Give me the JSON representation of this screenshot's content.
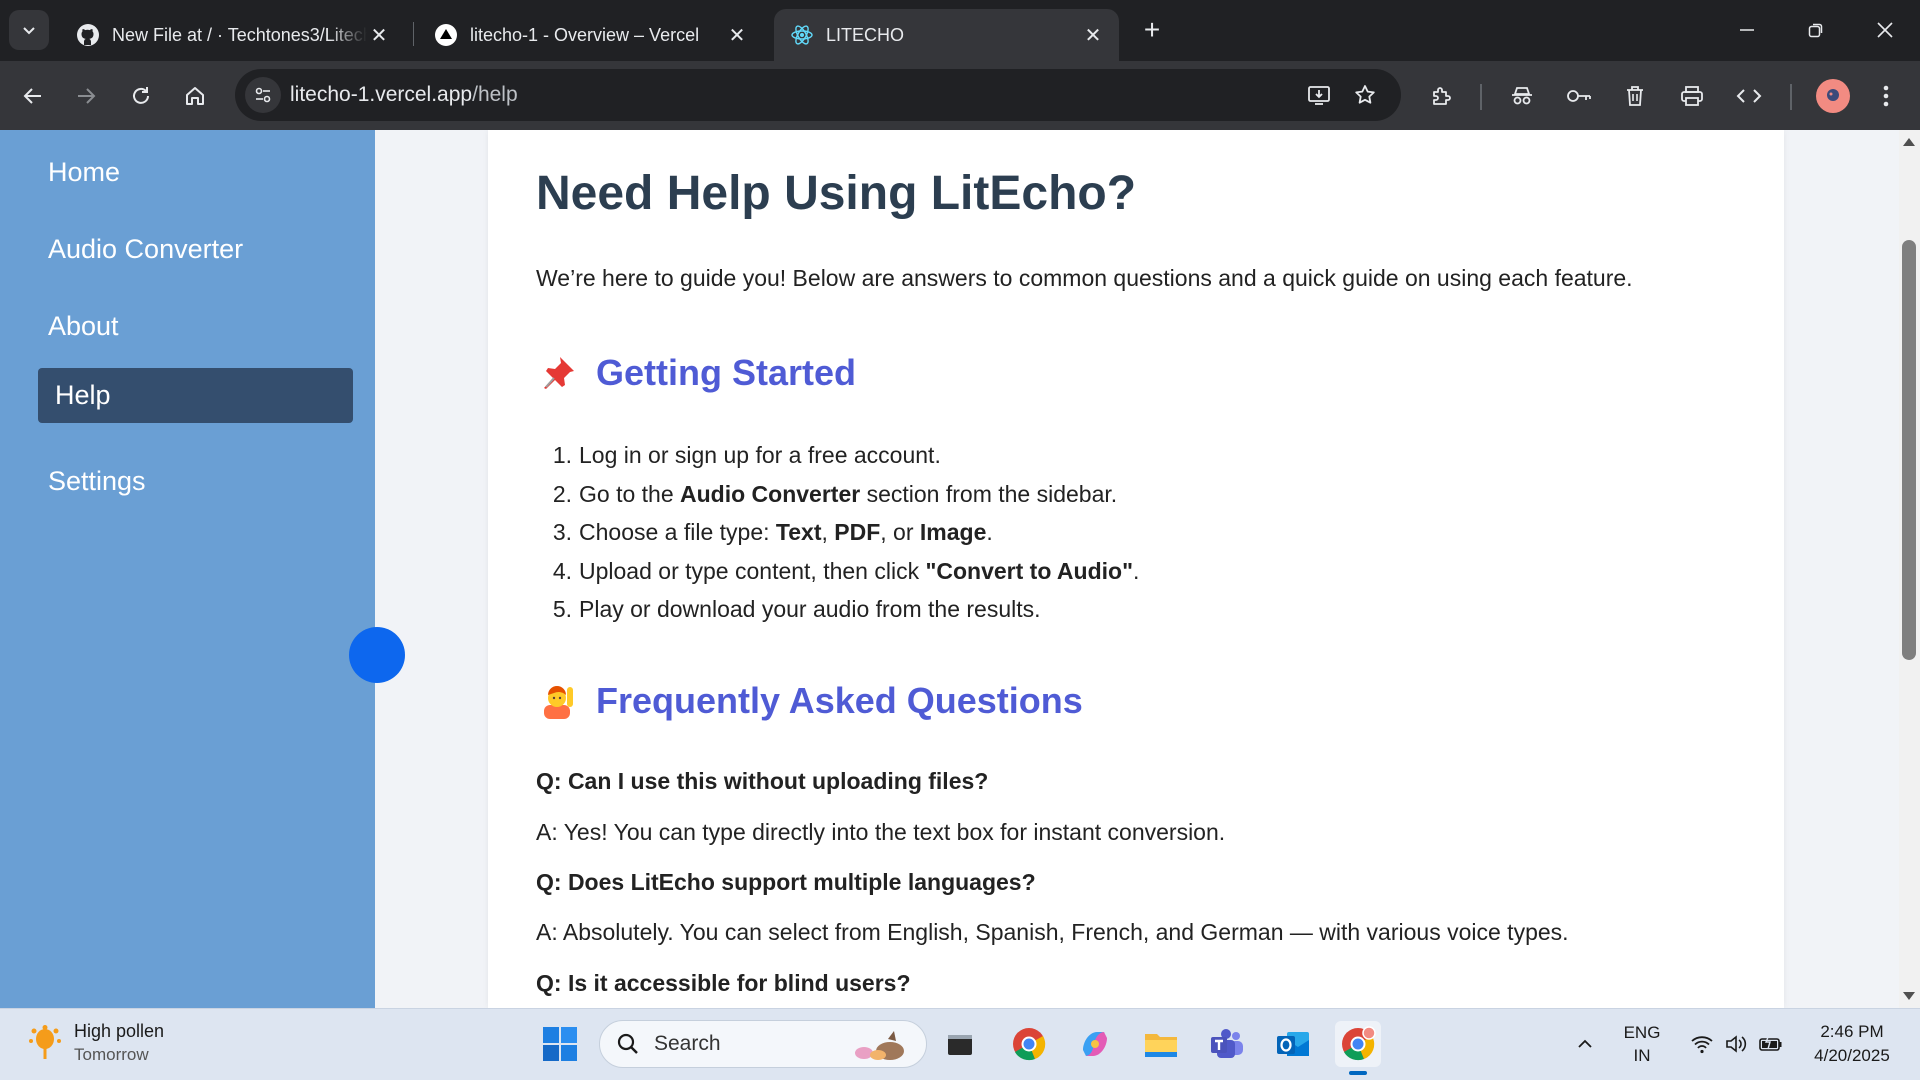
{
  "browser": {
    "tabs": [
      {
        "title": "New File at / · Techtones3/Litecho",
        "icon": "github-icon",
        "active": false
      },
      {
        "title": "litecho-1 - Overview – Vercel",
        "icon": "vercel-icon",
        "active": false
      },
      {
        "title": "LITECHO",
        "icon": "react-icon",
        "active": true
      }
    ],
    "url_host": "litecho-1.vercel.app",
    "url_path": "/help"
  },
  "sidebar": {
    "items": [
      {
        "label": "Home",
        "active": false
      },
      {
        "label": "Audio Converter",
        "active": false
      },
      {
        "label": "About",
        "active": false
      },
      {
        "label": "Help",
        "active": true
      },
      {
        "label": "Settings",
        "active": false
      }
    ]
  },
  "main": {
    "title": "Need Help Using LitEcho?",
    "intro": "We’re here to guide you! Below are answers to common questions and a quick guide on using each feature.",
    "getting_started": {
      "heading": "Getting Started",
      "emoji": "pushpin-icon",
      "steps": [
        {
          "n": "1.",
          "parts": [
            {
              "t": "Log in or sign up for a free account.",
              "b": false
            }
          ]
        },
        {
          "n": "2.",
          "parts": [
            {
              "t": "Go to the ",
              "b": false
            },
            {
              "t": "Audio Converter",
              "b": true
            },
            {
              "t": " section from the sidebar.",
              "b": false
            }
          ]
        },
        {
          "n": "3.",
          "parts": [
            {
              "t": "Choose a file type: ",
              "b": false
            },
            {
              "t": "Text",
              "b": true
            },
            {
              "t": ", ",
              "b": false
            },
            {
              "t": "PDF",
              "b": true
            },
            {
              "t": ", or ",
              "b": false
            },
            {
              "t": "Image",
              "b": true
            },
            {
              "t": ".",
              "b": false
            }
          ]
        },
        {
          "n": "4.",
          "parts": [
            {
              "t": "Upload or type content, then click ",
              "b": false
            },
            {
              "t": "\"Convert to Audio\"",
              "b": true
            },
            {
              "t": ".",
              "b": false
            }
          ]
        },
        {
          "n": "5.",
          "parts": [
            {
              "t": "Play or download your audio from the results.",
              "b": false
            }
          ]
        }
      ]
    },
    "faq": {
      "heading": "Frequently Asked Questions",
      "emoji": "person-raising-hand-icon",
      "items": [
        {
          "q": "Q: Can I use this without uploading files?",
          "a": "A: Yes! You can type directly into the text box for instant conversion."
        },
        {
          "q": "Q: Does LitEcho support multiple languages?",
          "a": "A: Absolutely. You can select from English, Spanish, French, and German — with various voice types."
        },
        {
          "q": "Q: Is it accessible for blind users?",
          "a": ""
        }
      ]
    }
  },
  "taskbar": {
    "weather_title": "High pollen",
    "weather_sub": "Tomorrow",
    "search_label": "Search",
    "lang_top": "ENG",
    "lang_bottom": "IN",
    "time": "2:46 PM",
    "date": "4/20/2025"
  },
  "colors": {
    "sidebar": "#6a9fd4",
    "sidebar_active": "#344e6e",
    "heading": "#2c3e50",
    "accent_heading": "#4f5bd5",
    "bubble": "#0d67ee"
  }
}
